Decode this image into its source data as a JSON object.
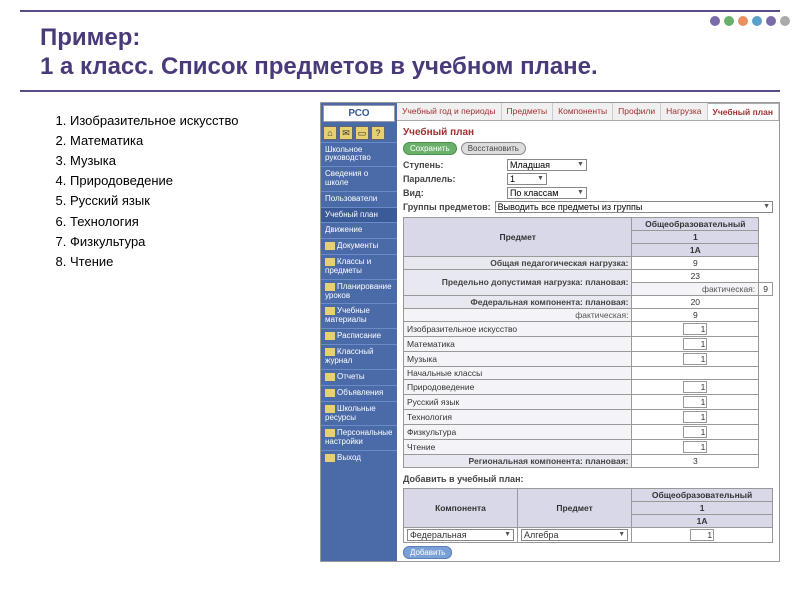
{
  "title_line1": "Пример:",
  "title_line2": "1 а класс. Список предметов в учебном плане.",
  "subjects": [
    "Изобразительное искусство",
    "Математика",
    "Музыка",
    "Природоведение",
    "Русский язык",
    "Технология",
    "Физкультура",
    "Чтение"
  ],
  "logo": "РСО",
  "sidebar": {
    "items": [
      "Школьное руководство",
      "Сведения о школе",
      "Пользователи",
      "Учебный план",
      "Движение",
      "Документы",
      "Классы и предметы",
      "Планирование уроков",
      "Учебные материалы",
      "Расписание",
      "Классный журнал",
      "Отчеты",
      "Объявления",
      "Школьные ресурсы",
      "Персональные настройки",
      "Выход"
    ]
  },
  "tabs": [
    "Учебный год и периоды",
    "Предметы",
    "Компоненты",
    "Профили",
    "Нагрузка",
    "Учебный план"
  ],
  "panel_title": "Учебный план",
  "btn_save": "Сохранить",
  "btn_restore": "Восстановить",
  "btn_add": "Добавить",
  "form": {
    "stupen_label": "Ступень:",
    "stupen_val": "Младшая",
    "parallel_label": "Параллель:",
    "parallel_val": "1",
    "vid_label": "Вид:",
    "vid_val": "По классам",
    "groups_label": "Группы предметов:",
    "groups_val": "Выводить все предметы из группы"
  },
  "table": {
    "predmet": "Предмет",
    "edu_header": "Общеобразовательный",
    "col_num": "1",
    "col_class": "1А",
    "row_total": "Общая педагогическая нагрузка:",
    "total_val": "9",
    "row_limit": "Предельно допустимая нагрузка:",
    "row_plan": "плановая:",
    "plan_val": "23",
    "row_fact": "фактическая:",
    "fact_val": "9",
    "row_fed": "Федеральная компонента:",
    "fed_plan_val": "20",
    "fed_fact_val": "9",
    "subjects": [
      {
        "name": "Изобразительное искусство",
        "val": "1"
      },
      {
        "name": "Математика",
        "val": "1"
      },
      {
        "name": "Музыка",
        "val": "1"
      },
      {
        "name": "Начальные классы",
        "val": ""
      },
      {
        "name": "Природоведение",
        "val": "1"
      },
      {
        "name": "Русский язык",
        "val": "1"
      },
      {
        "name": "Технология",
        "val": "1"
      },
      {
        "name": "Физкультура",
        "val": "1"
      },
      {
        "name": "Чтение",
        "val": "1"
      }
    ],
    "row_region": "Региональная компонента:",
    "region_plan_val": "3"
  },
  "add_section": {
    "title": "Добавить в учебный план:",
    "col_comp": "Компонента",
    "col_subj": "Предмет",
    "val_comp": "Федеральная",
    "val_subj": "Алгебра",
    "val_num": "1"
  },
  "dots_colors": [
    "#7a6aa8",
    "#6ab06a",
    "#e89060",
    "#5aa0c8",
    "#7a6aa8",
    "#aaa"
  ]
}
